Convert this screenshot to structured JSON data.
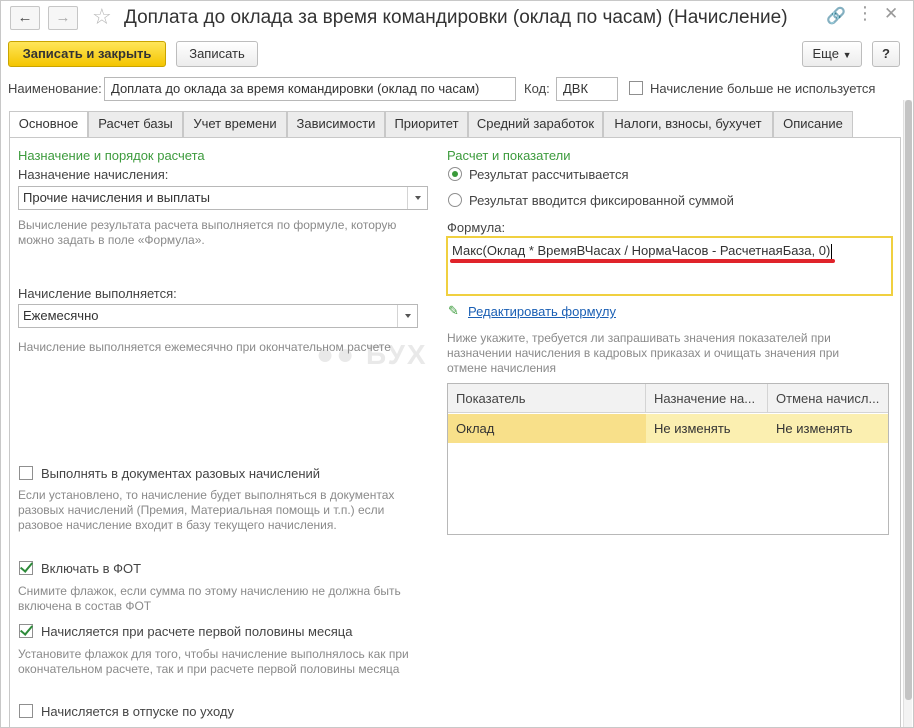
{
  "window": {
    "title": "Доплата до оклада за время командировки (оклад по часам) (Начисление)"
  },
  "toolbar": {
    "save_close_label": "Записать и закрыть",
    "save_label": "Записать",
    "more_label": "Еще",
    "help_label": "?"
  },
  "header": {
    "name_label": "Наименование:",
    "name_value": "Доплата до оклада за время командировки (оклад по часам)",
    "code_label": "Код:",
    "code_value": "ДВК",
    "unused_label": "Начисление больше не используется"
  },
  "tabs": [
    {
      "label": "Основное"
    },
    {
      "label": "Расчет базы"
    },
    {
      "label": "Учет времени"
    },
    {
      "label": "Зависимости"
    },
    {
      "label": "Приоритет"
    },
    {
      "label": "Средний заработок"
    },
    {
      "label": "Налоги, взносы, бухучет"
    },
    {
      "label": "Описание"
    }
  ],
  "left": {
    "section_title": "Назначение и порядок расчета",
    "purpose_label": "Назначение начисления:",
    "purpose_value": "Прочие начисления и выплаты",
    "purpose_hint": "Вычисление результата расчета выполняется по формуле, которую можно задать в поле «Формула».",
    "period_label": "Начисление выполняется:",
    "period_value": "Ежемесячно",
    "period_hint": "Начисление выполняется ежемесячно при окончательном расчете",
    "one_time_label": "Выполнять в документах разовых начислений",
    "one_time_hint": "Если установлено, то начисление будет выполняться в документах разовых начислений (Премия, Материальная помощь и т.п.) если разовое начисление входит в базу текущего начисления.",
    "fot_label": "Включать в ФОТ",
    "fot_hint": "Снимите флажок, если сумма по этому начислению не должна быть включена в состав ФОТ",
    "first_half_label": "Начисляется при расчете первой половины месяца",
    "first_half_hint": "Установите флажок для того, чтобы начисление выполнялось как при окончательном расчете, так и при расчете первой половины месяца",
    "leave_label": "Начисляется в отпуске по уходу"
  },
  "right": {
    "section_title": "Расчет и показатели",
    "radio_calc_label": "Результат рассчитывается",
    "radio_fixed_label": "Результат вводится фиксированной суммой",
    "formula_label": "Формула:",
    "formula_value": "Макс(Оклад * ВремяВЧасах / НормаЧасов - РасчетнаяБаза, 0)",
    "edit_formula_label": "Редактировать формулу",
    "indicators_hint": "Ниже укажите, требуется ли запрашивать значения показателей при назначении начисления в кадровых приказах и очищать значения при отмене начисления",
    "table": {
      "columns": [
        "Показатель",
        "Назначение на...",
        "Отмена начисл..."
      ],
      "rows": [
        [
          "Оклад",
          "Не изменять",
          "Не изменять"
        ]
      ]
    }
  },
  "watermark": "БУХ",
  "colors": {
    "accent_yellow": "#f4c500",
    "section_green": "#3d9b3d",
    "link_blue": "#1a5fb4",
    "selected_row": "#fbefb0",
    "annotation_red": "#e0232a"
  }
}
